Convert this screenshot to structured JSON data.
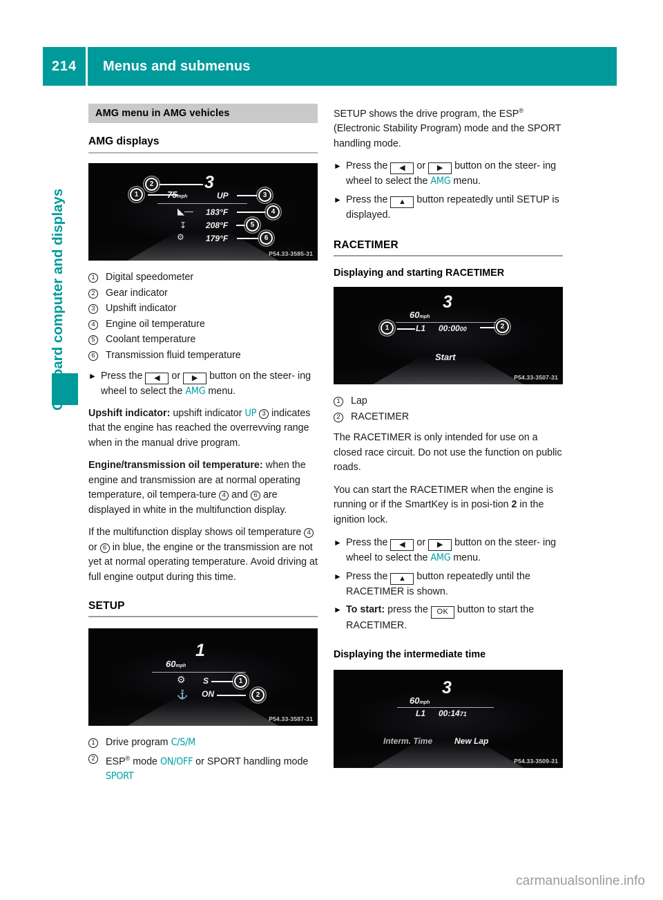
{
  "header": {
    "page_number": "214",
    "title": "Menus and submenus"
  },
  "sidebar": {
    "chapter_label": "On-board computer and displays"
  },
  "watermark": "carmanualsonline.info",
  "left_column": {
    "gray_heading": "AMG menu in AMG vehicles",
    "sub_heading": "AMG displays",
    "amg_display_image": {
      "gear": "3",
      "speed": "75",
      "speed_unit": "mph",
      "upshift": "UP",
      "oil_temp": "183°F",
      "coolant_temp": "208°F",
      "transmission_temp": "179°F",
      "image_code": "P54.33-3585-31",
      "callouts": [
        "1",
        "2",
        "3",
        "4",
        "5",
        "6"
      ]
    },
    "legend": [
      {
        "num": "1",
        "label": "Digital speedometer"
      },
      {
        "num": "2",
        "label": "Gear indicator"
      },
      {
        "num": "3",
        "label": "Upshift indicator"
      },
      {
        "num": "4",
        "label": "Engine oil temperature"
      },
      {
        "num": "5",
        "label": "Coolant temperature"
      },
      {
        "num": "6",
        "label": "Transmission fluid temperature"
      }
    ],
    "bullet_press": {
      "part1": "Press the",
      "or": "or",
      "part2": "button on the steer-",
      "part3": "ing wheel to select the",
      "menu_code": "AMG",
      "part4": "menu."
    },
    "upshift_para": {
      "bold_lead": "Upshift indicator:",
      "text1": "upshift indicator",
      "code": "UP",
      "ref": "3",
      "text2": "indicates that the engine has reached the overrevving range when in the manual drive program."
    },
    "oil_temp_para": {
      "bold_lead": "Engine/transmission oil temperature:",
      "text1": "when the engine and transmission are at normal operating temperature, oil tempera-ture",
      "ref1": "4",
      "and": "and",
      "ref2": "6",
      "text2": "are displayed in white in the multifunction display."
    },
    "blue_temp_para": {
      "text1": "If the multifunction display shows oil temperature",
      "ref1": "4",
      "or": "or",
      "ref2": "6",
      "text2": "in blue, the engine or the transmission are not yet at normal operating temperature. Avoid driving at full engine output during this time."
    },
    "setup_heading": "SETUP",
    "setup_image": {
      "gear": "1",
      "speed": "60",
      "speed_unit": "mph",
      "drive_program": "S",
      "esp_mode": "ON",
      "image_code": "P54.33-3587-31",
      "callouts": [
        "1",
        "2"
      ]
    },
    "setup_legend": [
      {
        "num": "1",
        "text_before": "Drive program",
        "code": "C/S/M",
        "text_after": ""
      },
      {
        "num": "2",
        "text_before": "ESP",
        "sup": "®",
        "text_mid": "mode",
        "code": "ON/OFF",
        "text_after": "or SPORT handling mode",
        "code2": "SPORT"
      }
    ]
  },
  "right_column": {
    "setup_intro": "SETUP shows the drive program, the ESP® (Electronic Stability Program) mode and the SPORT handling mode.",
    "setup_intro_part1": "SETUP shows the drive program, the ESP",
    "setup_intro_sup": "®",
    "setup_intro_part2": "(Electronic Stability Program) mode and the SPORT handling mode.",
    "bullet_press_amg": {
      "part1": "Press the",
      "or": "or",
      "part2": "button on the steer-",
      "part3": "ing wheel to select the",
      "menu_code": "AMG",
      "part4": "menu."
    },
    "bullet_press_up_setup": {
      "part1": "Press the",
      "part2": "button repeatedly until",
      "part3": "SETUP is displayed."
    },
    "racetimer_heading": "RACETIMER",
    "racetimer_subheading": "Displaying and starting RACETIMER",
    "racetimer_image": {
      "gear": "3",
      "speed": "60",
      "speed_unit": "mph",
      "lap_label": "L1",
      "time": "00:00",
      "time_decimals": "00",
      "action": "Start",
      "image_code": "P54.33-3507-31",
      "callouts": [
        "1",
        "2"
      ]
    },
    "racetimer_legend": [
      {
        "num": "1",
        "label": "Lap"
      },
      {
        "num": "2",
        "label": "RACETIMER"
      }
    ],
    "warning_para": "The RACETIMER is only intended for use on a closed race circuit. Do not use the function on public roads.",
    "start_para_1": "You can start the RACETIMER when the engine is running or if the SmartKey is in posi-tion",
    "start_para_bold": "2",
    "start_para_2": "in the ignition lock.",
    "bullet_press_amg2": {
      "part1": "Press the",
      "or": "or",
      "part2": "button on the steer-",
      "part3": "ing wheel to select the",
      "menu_code": "AMG",
      "part4": "menu."
    },
    "bullet_press_up_race": {
      "part1": "Press the",
      "part2": "button repeatedly until the",
      "part3": "RACETIMER is shown."
    },
    "bullet_to_start": {
      "bold_lead": "To start:",
      "part1": "press the",
      "key": "OK",
      "part2": "button to start the",
      "part3": "RACETIMER."
    },
    "intermediate_heading": "Displaying the intermediate time",
    "intermediate_image": {
      "gear": "3",
      "speed": "60",
      "speed_unit": "mph",
      "lap_label": "L1",
      "time": "00:14",
      "time_decimals": "71",
      "action_left": "Interm. Time",
      "action_right": "New Lap",
      "image_code": "P54.33-3509-31"
    }
  },
  "colors": {
    "teal": "#009a9a",
    "code_teal": "#00a0a8",
    "gray_heading_bg": "#c9c9c9"
  }
}
